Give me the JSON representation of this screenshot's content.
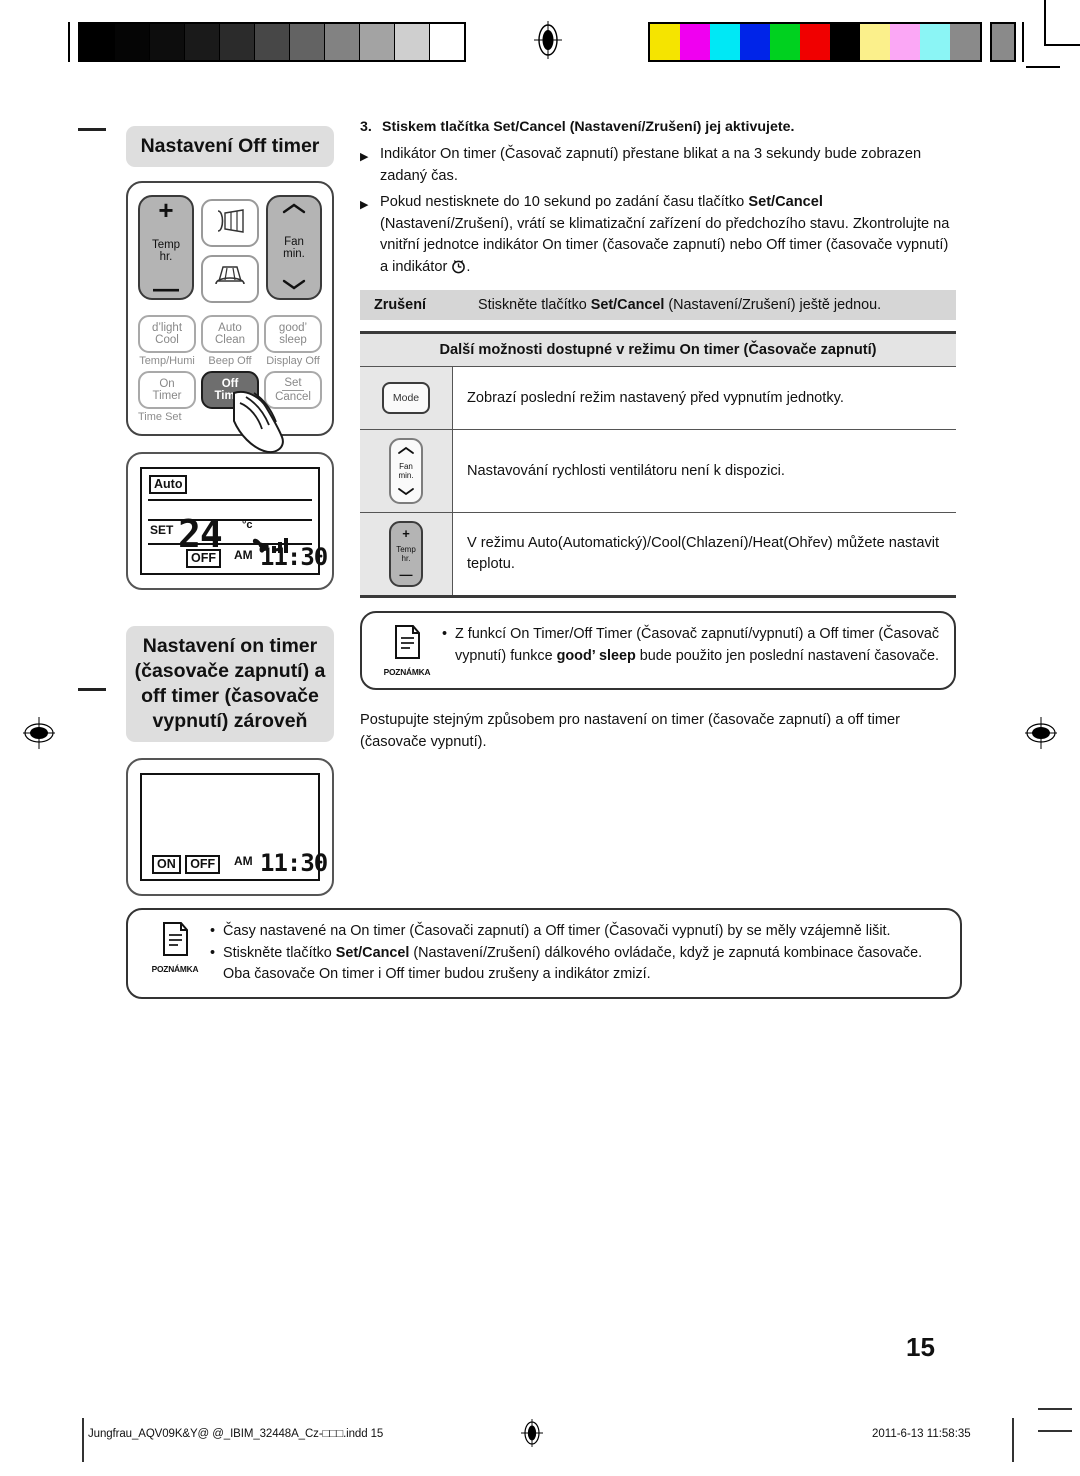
{
  "calibration": {
    "gray_ramp": [
      "#000000",
      "#050505",
      "#0d0d0d",
      "#1a1a1a",
      "#2b2b2b",
      "#474747",
      "#636363",
      "#828282",
      "#a3a3a3",
      "#cfcfcf",
      "#ffffff"
    ],
    "color_bar": [
      "#f5e400",
      "#f000f0",
      "#00e8f5",
      "#0024e8",
      "#00d11f",
      "#f00000",
      "#000000",
      "#fbf08b",
      "#fba7f5",
      "#8bf5f5",
      "#8a8a8a"
    ]
  },
  "left": {
    "section1_title": "Nastavení Off timer",
    "remote": {
      "temp_button": {
        "plus": "+",
        "label_1": "Temp",
        "label_2": "hr.",
        "minus": "—"
      },
      "fan_button": {
        "up": "⌃",
        "label_1": "Fan",
        "label_2": "min.",
        "down": "⌄"
      },
      "swing_icon_1": "vertical-swing-icon",
      "swing_icon_2": "horizontal-swing-icon",
      "row2": [
        {
          "line1": "d’light",
          "line2": "Cool",
          "sub": "Temp/Humi"
        },
        {
          "line1": "Auto",
          "line2": "Clean",
          "sub": "Beep Off"
        },
        {
          "line1": "good’",
          "line2": "sleep",
          "sub": "Display Off"
        }
      ],
      "row3": [
        {
          "line1": "On",
          "line2": "Timer",
          "sub": "Time Set"
        },
        {
          "line1": "Off",
          "line2": "Timer",
          "sub": ""
        },
        {
          "line1": "Set",
          "line2": "Cancel",
          "sub": ""
        }
      ]
    },
    "lcd1": {
      "mode_badge": "Auto",
      "set_label": "SET",
      "temperature": "24",
      "unit": "°c",
      "fan_icon": "fan-blade-icon",
      "timer_badge": "OFF",
      "ampm": "AM",
      "time": "11:30"
    },
    "section2_title": "Nastavení on timer (časovače zapnutí) a off timer (časovače vypnutí) zároveň",
    "lcd2": {
      "on_badge": "ON",
      "off_badge": "OFF",
      "ampm": "AM",
      "time": "11:30"
    }
  },
  "right": {
    "step": {
      "number": "3.",
      "text_a": "Stiskem tlačítka ",
      "text_b": "Set/Cancel",
      "text_c": " (Nastavení/Zrušení) jej aktivujete."
    },
    "bullets": [
      "Indikátor On timer (Časovač zapnutí) přestane blikat a na 3 sekundy bude zobrazen zadaný čas.",
      "Pokud nestisknete do 10 sekund po zadání času tlačítko Set/Cancel (Nastavení/Zrušení), vrátí se klimatizační zařízení do předchozího stavu. Zkontrolujte na vnitřní jednotce indikátor On timer (časovače zapnutí) nebo Off timer (časovače vypnutí) a indikátor ."
    ],
    "cancel_row": {
      "label": "Zrušení",
      "text_a": "Stiskněte tlačítko ",
      "text_b": "Set/Cancel",
      "text_c": " (Nastavení/Zrušení) ještě jednou."
    },
    "options_table": {
      "header": "Další možnosti dostupné v režimu On timer (Časovače zapnutí)",
      "rows": [
        {
          "icon": "mode-button-icon",
          "icon_label": "Mode",
          "text": "Zobrazí poslední režim nastavený před vypnutím jednotky."
        },
        {
          "icon": "fan-speed-button-icon",
          "icon_label_1": "Fan",
          "icon_label_2": "min.",
          "text": "Nastavování rychlosti ventilátoru není k dispozici."
        },
        {
          "icon": "temp-button-icon",
          "icon_label_1": "Temp",
          "icon_label_2": "hr.",
          "text": "V režimu Auto(Automatický)/Cool(Chlazení)/Heat(Ohřev) můžete nastavit teplotu."
        }
      ]
    },
    "note1": {
      "icon_caption": "POZNÁMKA",
      "lines": [
        {
          "a": "Z funkcí On Timer/Off Timer (Časovač zapnutí/vypnutí) a Off timer (Časovač vypnutí) funkce ",
          "b": "good’ sleep",
          "c": " bude použito jen poslední nastavení časovače."
        }
      ]
    },
    "paragraph": "Postupujte stejným způsobem pro nastavení on timer (časovače zapnutí) a off timer (časovače vypnutí)."
  },
  "note2": {
    "icon_caption": "POZNÁMKA",
    "line1": "Časy nastavené na On timer (Časovači zapnutí) a Off timer (Časovači vypnutí) by se měly vzájemně lišit.",
    "line2_a": "Stiskněte tlačítko ",
    "line2_b": "Set/Cancel",
    "line2_c": " (Nastavení/Zrušení) dálkového ovládače, když je zapnutá kombinace časovače. Oba časovače On timer i Off timer budou zrušeny a indikátor zmizí."
  },
  "page_number": "15",
  "footer": {
    "file": "Jungfrau_AQV09K&Y@ @_IBIM_32448A_Cz-□□□.indd   15",
    "date": "2011-6-13   11:58:35"
  }
}
